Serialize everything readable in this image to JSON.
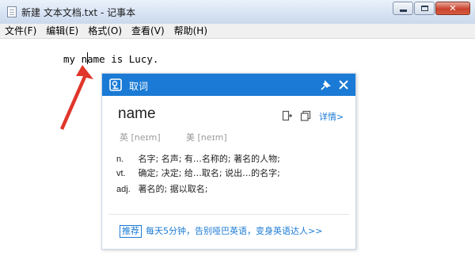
{
  "window": {
    "title": "新建 文本文档.txt - 记事本",
    "buttons": {
      "minimize": "",
      "maximize": "",
      "close": "✕"
    }
  },
  "menu": {
    "items": [
      {
        "label": "文件(F)"
      },
      {
        "label": "编辑(E)"
      },
      {
        "label": "格式(O)"
      },
      {
        "label": "查看(V)"
      },
      {
        "label": "帮助(H)"
      }
    ]
  },
  "editor": {
    "text": "my name is Lucy."
  },
  "dictionary_popup": {
    "header_title": "取词",
    "word": "name",
    "detail_link": "详情>",
    "pronunciations": {
      "uk": "英 [neɪm]",
      "us": "美 [neɪm]"
    },
    "definitions": [
      {
        "pos": "n.",
        "text": "名字; 名声; 有…名称的; 著名的人物;"
      },
      {
        "pos": "vt.",
        "text": "确定; 决定; 给…取名; 说出…的名字;"
      },
      {
        "pos": "adj.",
        "text": "著名的; 据以取名;"
      }
    ],
    "promo": {
      "tag": "推荐",
      "text": "每天5分钟，告别哑巴英语，变身英语达人>>"
    },
    "colors": {
      "accent": "#1a7ad5",
      "arrow": "#e0362b"
    }
  }
}
